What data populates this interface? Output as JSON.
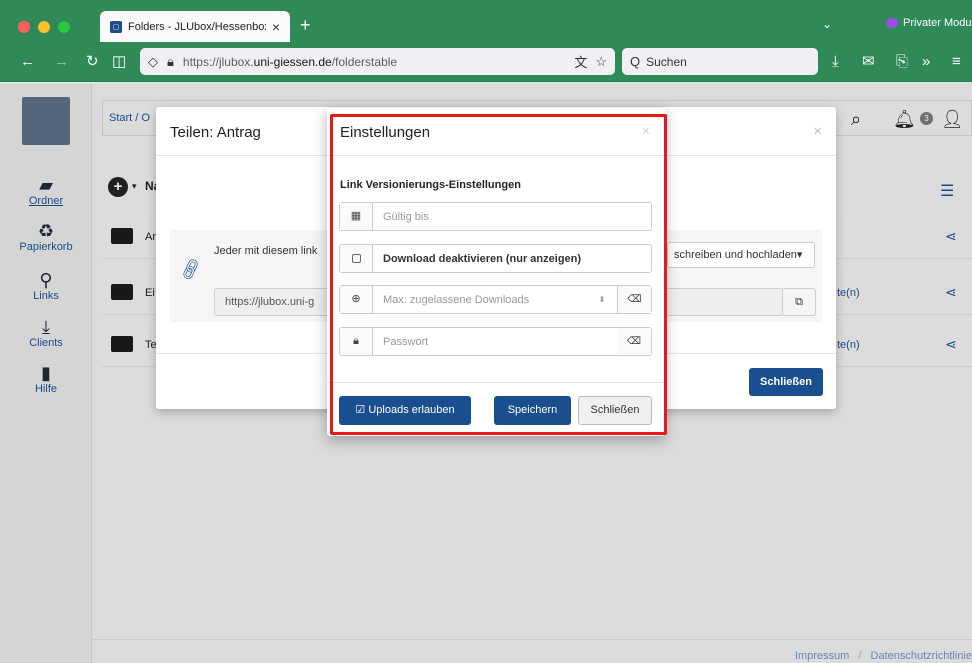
{
  "browser": {
    "tab_title": "Folders - JLUbox/Hessenbox",
    "tab_close": "×",
    "new_tab": "+",
    "private_mode": "Privater Modus",
    "url_prefix": "https://jlubox.",
    "url_host": "uni-giessen.de",
    "url_path": "/folderstable",
    "search_placeholder": "Suchen",
    "search_glyph": "Q"
  },
  "sidebar": {
    "items": [
      {
        "label": "Ordner",
        "glyph": "▰"
      },
      {
        "label": "Papierkorb",
        "glyph": "♻"
      },
      {
        "label": "Links",
        "glyph": "⚲"
      },
      {
        "label": "Clients",
        "glyph": "⤓"
      },
      {
        "label": "Hilfe",
        "glyph": "▮"
      }
    ]
  },
  "main": {
    "breadcrumb": "Start / O",
    "toolbar_prefix": "Na",
    "rows": [
      {
        "prefix": "An",
        "trail": ""
      },
      {
        "prefix": "Ei",
        "trail": "te(n)"
      },
      {
        "prefix": "Te",
        "trail": "te(n)"
      }
    ],
    "notification_count": "3"
  },
  "footer": {
    "impressum": "Impressum",
    "separator": "/",
    "datenschutz": "Datenschutzrichtlinie"
  },
  "share_modal": {
    "title": "Teilen: Antrag",
    "close_x": "×",
    "everyone_text": "Jeder mit diesem link",
    "permission": "schreiben und hochladen▾",
    "url_value": "https://jlubox.uni-g",
    "close_button": "Schließen"
  },
  "settings_modal": {
    "title": "Einstellungen",
    "close_x": "×",
    "section_label": "Link Versionierungs-Einstellungen",
    "valid_until_placeholder": "Gültig bis",
    "download_disable_label": "Download deaktivieren (nur anzeigen)",
    "max_downloads_placeholder": "Max. zugelassene Downloads",
    "password_placeholder": "Passwort",
    "uploads_button": "☑ Uploads erlauben",
    "save_button": "Speichern",
    "close_button": "Schließen"
  },
  "colors": {
    "browser_green": "#2f8a57",
    "primary_blue": "#1a4f8f",
    "highlight_red": "#e41b17"
  }
}
